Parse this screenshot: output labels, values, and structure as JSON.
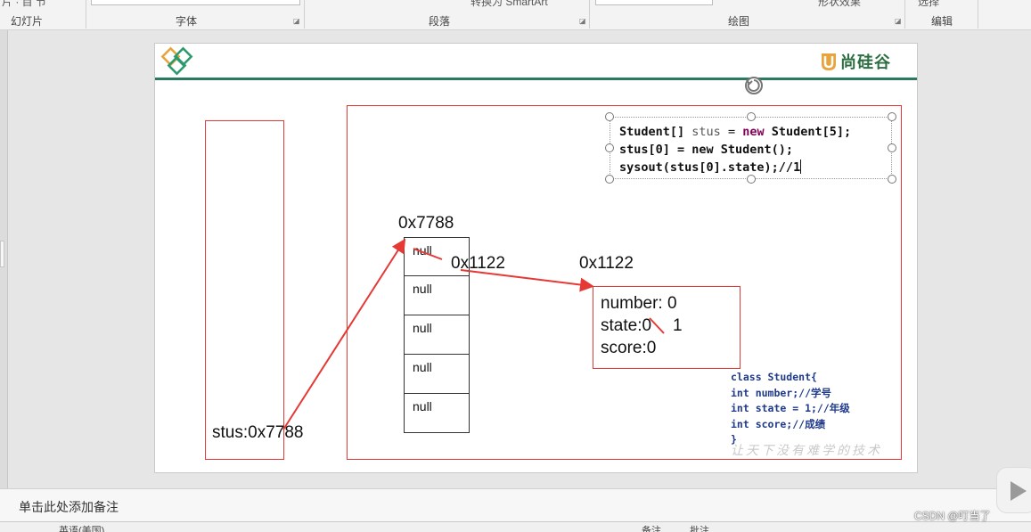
{
  "ribbon": {
    "groups": [
      {
        "label": "幻灯片"
      },
      {
        "label": "字体"
      },
      {
        "label": "段落"
      },
      {
        "label": "绘图"
      },
      {
        "label": "编辑"
      }
    ],
    "partial": {
      "smartart": "转换为 SmartArt",
      "shape_effects": "形状效果",
      "select": "选择"
    }
  },
  "slide": {
    "brand": "尚硅谷",
    "stack_var": "stus:0x7788",
    "array_addr": "0x7788",
    "array_cells": [
      "null",
      "null",
      "null",
      "null",
      "null"
    ],
    "elem_addr": "0x1122",
    "obj_addr": "0x1122",
    "object_fields": {
      "number": "number: 0",
      "state": "state:0",
      "state_new": "1",
      "score": "score:0"
    },
    "code": {
      "line1": {
        "type": "Student[]",
        "var": "stus",
        "eq": "=",
        "kw": "new",
        "rest": "Student[5];"
      },
      "line2": "stus[0] = new Student();",
      "line3": "sysout(stus[0].state);//1"
    },
    "class_def": [
      "class Student{",
      "int number;//学号",
      "int state = 1;//年级",
      "int score;//成绩",
      "}"
    ],
    "slogan": "让天下没有难学的技术"
  },
  "notes": {
    "placeholder": "单击此处添加备注"
  },
  "status": {
    "lang": "英语(美国)",
    "notes_btn": "备注",
    "comments_btn": "批注"
  },
  "watermark": "CSDN @叮当了",
  "colors": {
    "accent_red": "#e53935",
    "brand_green": "#2b7a5e"
  }
}
